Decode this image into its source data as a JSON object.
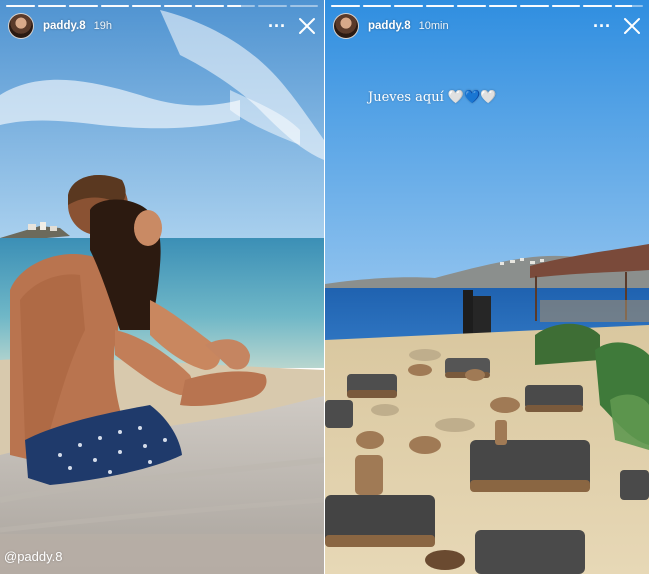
{
  "stories": [
    {
      "username": "paddy.8",
      "time": "19h",
      "mention": "@paddy.8",
      "progress": [
        1,
        1,
        1,
        1,
        1,
        1,
        1,
        0.5,
        0,
        0
      ]
    },
    {
      "username": "paddy.8",
      "time": "10min",
      "caption": "Jueves aquí 🤍💙🤍",
      "progress": [
        1,
        1,
        1,
        1,
        1,
        1,
        1,
        1,
        1,
        0.6
      ]
    }
  ],
  "icons": {
    "more": "more-options-icon",
    "close": "close-icon"
  }
}
